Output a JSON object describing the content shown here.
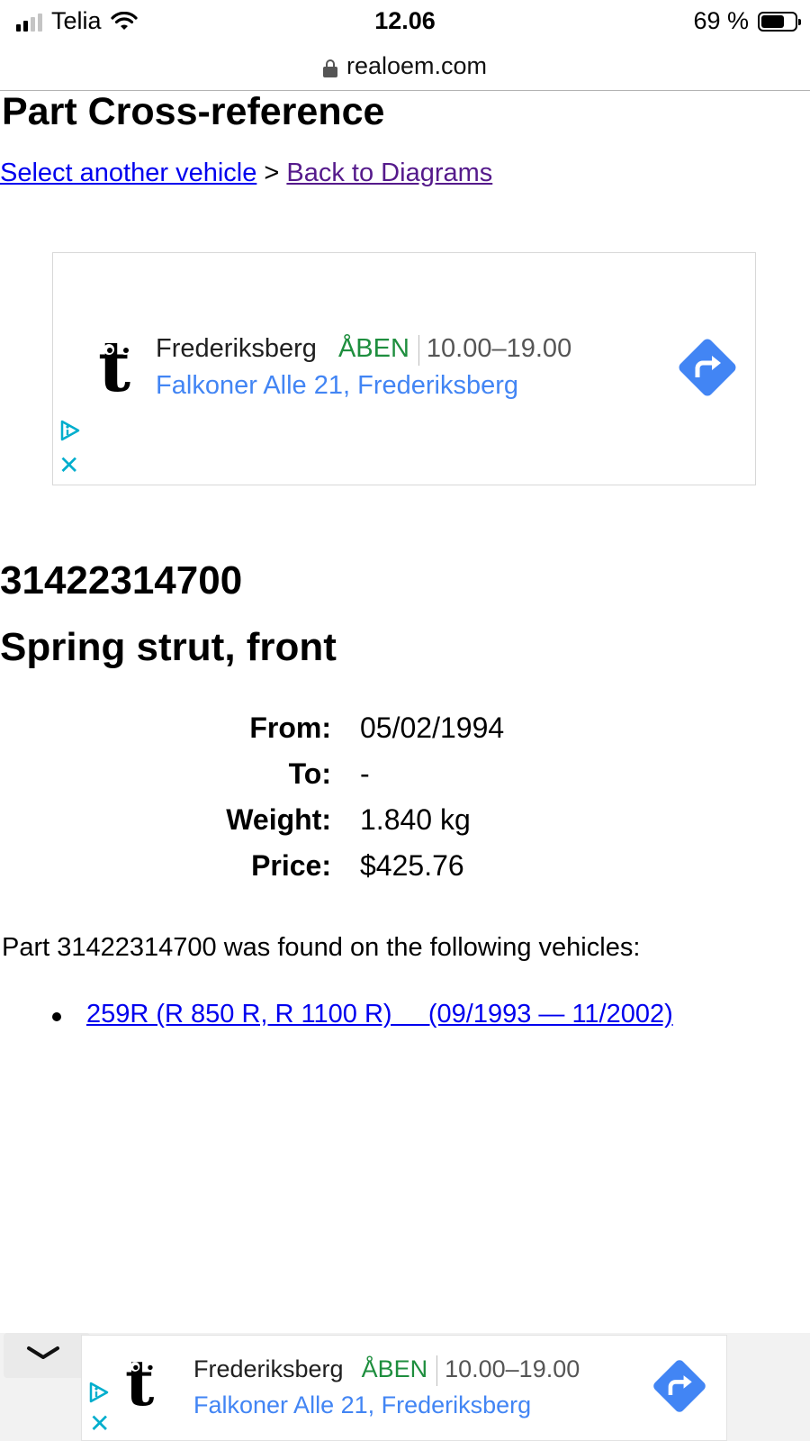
{
  "status_bar": {
    "carrier": "Telia",
    "time": "12.06",
    "battery_text": "69 %",
    "battery_level": 0.69,
    "icons": [
      "cellular-signal-icon",
      "wifi-icon",
      "battery-icon"
    ]
  },
  "browser": {
    "url": "realoem.com",
    "icon": "lock-icon"
  },
  "page": {
    "title": "Part Cross-reference",
    "breadcrumb": {
      "link1": "Select another vehicle",
      "separator": ">",
      "link2": "Back to Diagrams"
    }
  },
  "ad": {
    "name": "Frederiksberg",
    "status": "ÅBEN",
    "hours": "10.00–19.00",
    "address": "Falkoner Alle 21, Frederiksberg",
    "logo_letter": "t",
    "icons": [
      "t-logo",
      "directions-icon",
      "ad-choices-icon",
      "close-icon"
    ],
    "colors": {
      "open": "#1e8e3e",
      "address": "#4285f4",
      "directions": "#4285f4",
      "close": "#00aecd"
    }
  },
  "part": {
    "number": "31422314700",
    "name": "Spring strut, front",
    "details": [
      {
        "label": "From:",
        "value": "05/02/1994"
      },
      {
        "label": "To:",
        "value": "-"
      },
      {
        "label": "Weight:",
        "value": "1.840 kg"
      },
      {
        "label": "Price:",
        "value": "$425.76"
      }
    ],
    "found_text": "Part 31422314700 was found on the following vehicles:",
    "vehicles": [
      {
        "label": "259R (R 850 R, R 1100 R)     (09/1993 — 11/2002)"
      }
    ]
  },
  "bottom_ad": {
    "name": "Frederiksberg",
    "status": "ÅBEN",
    "hours": "10.00–19.00",
    "address": "Falkoner Alle 21, Frederiksberg",
    "logo_letter": "t",
    "collapse_icon": "chevron-down-icon"
  },
  "links": {
    "color": "#0000ee",
    "visited_color": "#551a8b"
  }
}
